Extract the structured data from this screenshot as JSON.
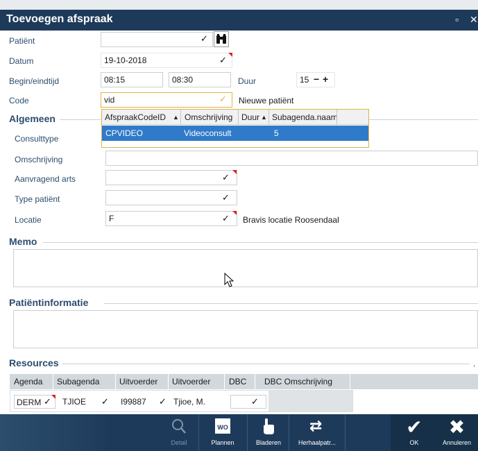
{
  "window": {
    "title": "Toevoegen afspraak"
  },
  "form": {
    "patient_label": "Patiënt",
    "datum_label": "Datum",
    "datum_value": "19-10-2018",
    "begin_label": "Begin/eindtijd",
    "begin_value": "08:15",
    "eind_value": "08:30",
    "duur_label": "Duur",
    "duur_value": "15",
    "code_label": "Code",
    "code_value": "vid",
    "code_side_text": "Nieuwe patiënt"
  },
  "dropdown": {
    "headers": [
      "AfspraakCodeID",
      "Omschrijving",
      "Duur",
      "Subagenda.naam"
    ],
    "rows": [
      {
        "code": "CPVIDEO",
        "omschrijving": "Videoconsult",
        "duur": "5",
        "subagenda": ""
      }
    ]
  },
  "algemeen": {
    "section_label": "Algemeen",
    "consulttype_label": "Consulttype",
    "omschrijving_label": "Omschrijving",
    "aanvragend_label": "Aanvragend arts",
    "typepatient_label": "Type patiënt",
    "locatie_label": "Locatie",
    "locatie_value": "F",
    "locatie_side_text": "Bravis locatie Roosendaal"
  },
  "memo": {
    "section_label": "Memo"
  },
  "patientinfo": {
    "section_label": "Patiëntinformatie"
  },
  "resources": {
    "section_label": "Resources",
    "trailing": ".",
    "headers": [
      "Agenda",
      "Subagenda",
      "Uitvoerder",
      "Uitvoerder",
      "DBC",
      "DBC Omschrijving"
    ],
    "row": {
      "agenda": "DERM",
      "subagenda": "TJIOE",
      "uitvoerder_code": "I99887",
      "uitvoerder_name": "Tjioe, M.",
      "dbc": ""
    }
  },
  "toolbar": {
    "detail_label": "Detail",
    "plannen_label": "Plannen",
    "plannen_icon_text": "WO",
    "bladeren_label": "Bladeren",
    "herhaal_label": "Herhaalpatr...",
    "ok_label": "OK",
    "annuleren_label": "Annuleren"
  },
  "colors": {
    "header": "#1e3a5a",
    "label": "#2c4d6e",
    "highlight": "#2f7ac9",
    "required_marker": "#e02020"
  }
}
